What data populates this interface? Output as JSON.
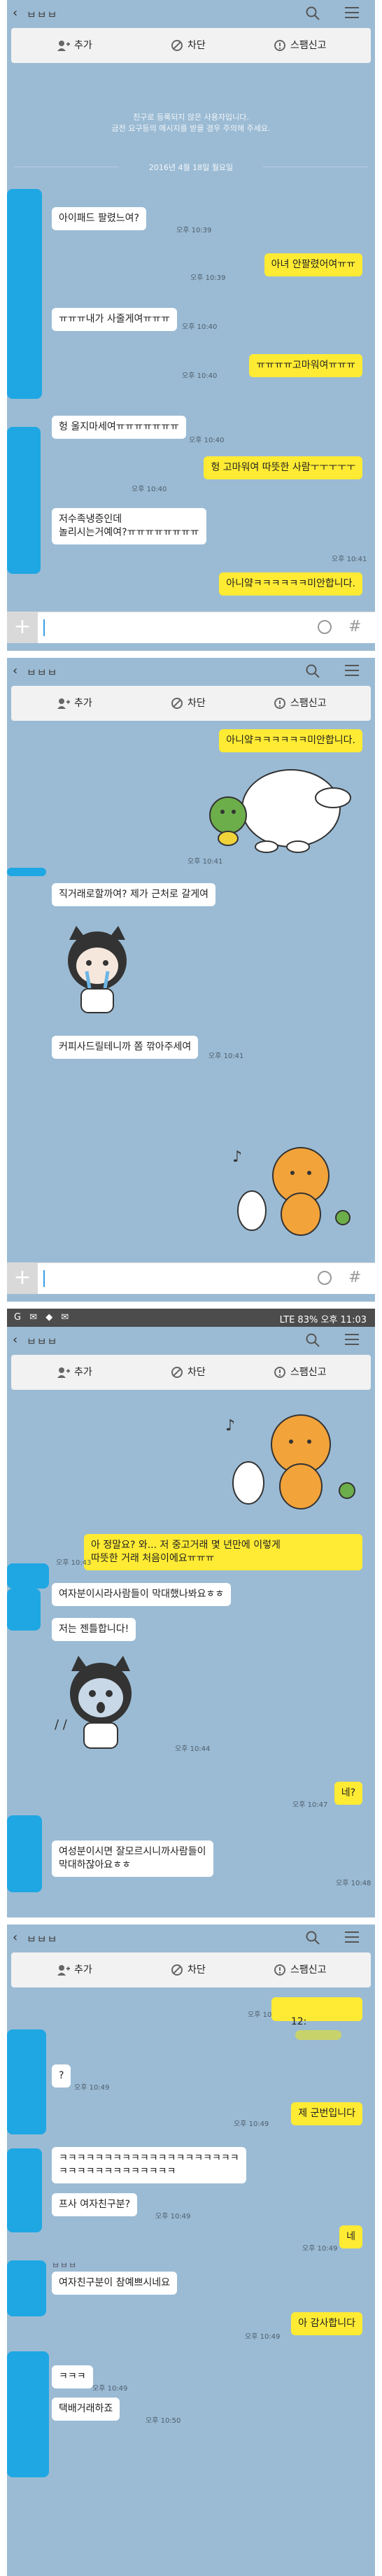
{
  "chat": {
    "title": "ㅂㅂㅂ",
    "actions": {
      "add": "추가",
      "block": "차단",
      "report": "스팸신고"
    },
    "notice": [
      "친구로 등록되지 않은 사용자입니다.",
      "금전 요구등의 메시지를 받을 경우 주의해 주세요."
    ],
    "date": "2016년 4월 18일 월요일"
  },
  "status_bar": {
    "battery": "83%",
    "time": "오후 11:03",
    "network": "LTE"
  },
  "panel1": {
    "m1": "아이패드 팔렸느여?",
    "t1": "오후 10:39",
    "m2": "아녀 안팔렸어여ㅠㅠ",
    "t2": "오후 10:39",
    "m3": "ㅠㅠㅠ내가 사줄게여ㅠㅠㅠ",
    "t3": "오후 10:40",
    "m4": "ㅠㅠㅠㅠ고마워여ㅠㅠㅠ",
    "t4": "오후 10:40",
    "m5": "헝 울지마세여ㅠㅠㅠㅠㅠㅠㅠ",
    "t5": "오후 10:40",
    "m6": "헝 고마워여 따뜻한 사람ㅜㅜㅜㅜㅜ",
    "t6": "오후 10:40",
    "m7": "저수족냉증인데\n놀리시는거예여?ㅠㅠㅠㅠㅠㅠㅠㅠ",
    "t7": "오후 10:41",
    "m8": "아니얔ㅋㅋㅋㅋㅋㅋ미안합니다."
  },
  "panel2": {
    "m1": "아니얔ㅋㅋㅋㅋㅋㅋ미안합니다.",
    "t1": "오후 10:41",
    "m2": "직거래로할까여? 제가 근처로 갈게여",
    "m3": "커피사드릴테니까 쫌 깎아주세여",
    "t3": "오후 10:41"
  },
  "panel3": {
    "m1": "아 정말요? 와... 저 중고거래 몇 년만에 이렇게\n따뜻한 거래 처음이에요ㅠㅠㅠ",
    "t1": "오후 10:43",
    "m2": "여자분이시라사람들이 막대했나봐요ㅎㅎ",
    "m3": "저는 젠틀합니다!",
    "t4": "오후 10:44",
    "m5": "네?",
    "t5": "오후 10:47",
    "m6": "여성분이시면 잘모르시니까사람들이\n막대하잖아요ㅎㅎ",
    "t6": "오후 10:48"
  },
  "panel4": {
    "t1": "오후 10:48",
    "m1": "12:",
    "m2": "?",
    "t2": "오후 10:49",
    "m3": "제 군번입니다",
    "t3": "오후 10:49",
    "m4": "ㅋㅋㅋㅋㅋㅋㅋㅋㅋㅋㅋㅋㅋㅋㅋㅋㅋㅋㅋㅋ\nㅋㅋㅋㅋㅋㅋㅋㅋㅋㅋㅋㅋㅋ",
    "m5": "프사 여자친구분?",
    "t5": "오후 10:49",
    "m6": "네",
    "t6": "오후 10:49",
    "sender": "ㅂㅂㅂ",
    "m7": "여자친구분이 참예쁘시네요",
    "m8": "아 감사합니다",
    "t8": "오후 10:49",
    "m9": "ㅋㅋㅋ",
    "t9": "오후 10:49",
    "m10": "택배거래하죠",
    "t10": "오후 10:50"
  },
  "colors": {
    "chat_bg": "#9bbbd4",
    "mine": "#ffeb33",
    "theirs": "#ffffff",
    "redaction": "#1fa7e3"
  },
  "icons": [
    "back-arrow-icon",
    "search-icon",
    "menu-icon",
    "add-friend-icon",
    "block-icon",
    "report-icon",
    "plus-icon",
    "emoji-icon",
    "hash-icon"
  ]
}
